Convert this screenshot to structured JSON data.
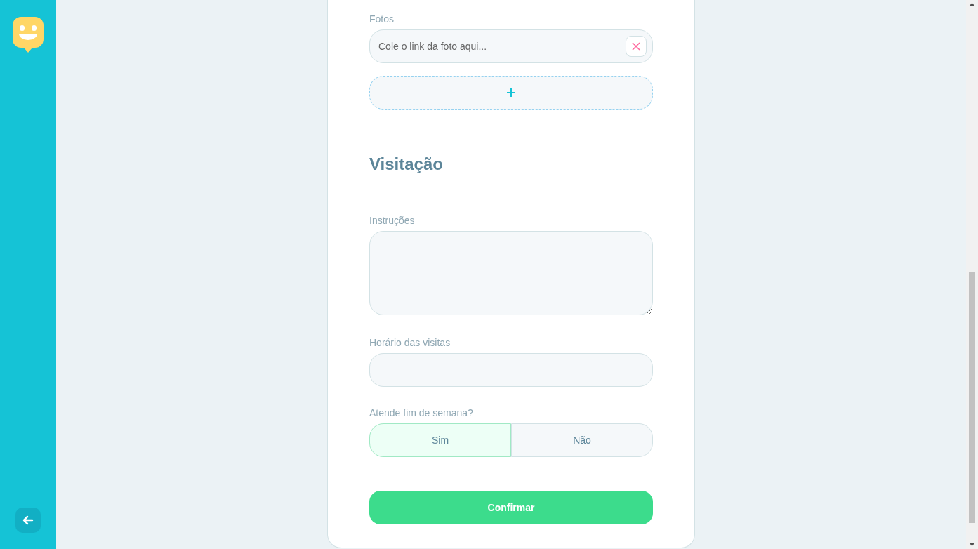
{
  "photos": {
    "label": "Fotos",
    "links": [
      {
        "placeholder": "Cole o link da foto aqui..."
      }
    ]
  },
  "visitation": {
    "title": "Visitação",
    "instructions": {
      "label": "Instruções"
    },
    "hours": {
      "label": "Horário das visitas"
    },
    "weekend": {
      "label": "Atende fim de semana?",
      "options": [
        {
          "label": "Sim",
          "selected": true
        },
        {
          "label": "Não",
          "selected": false
        }
      ]
    }
  },
  "confirm_button": "Confirmar"
}
